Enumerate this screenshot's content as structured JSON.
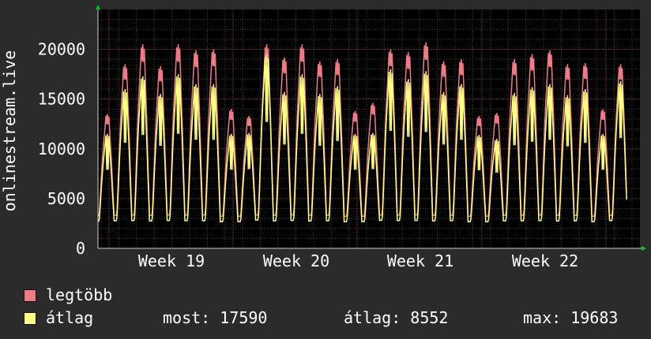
{
  "chart_data": {
    "type": "line",
    "ylabel": "onlinestream.live",
    "ylim": [
      0,
      24000
    ],
    "y_ticks": [
      0,
      5000,
      10000,
      15000,
      20000
    ],
    "y_tick_labels": [
      "0",
      "5000",
      "10000",
      "15000",
      "20000"
    ],
    "x_tick_labels": [
      "Week 19",
      "Week 20",
      "Week 21",
      "Week 22"
    ],
    "grid": true,
    "series": [
      {
        "name": "legtöbb",
        "color": "#f07a85",
        "daily_peaks": [
          13500,
          18500,
          20500,
          18300,
          20500,
          19900,
          20000,
          14000,
          13300,
          20500,
          19200,
          20500,
          18800,
          19000,
          13800,
          14600,
          20000,
          19700,
          20700,
          18800,
          19000,
          13300,
          13600,
          19000,
          19500,
          19900,
          18500,
          18600,
          14000,
          18500
        ]
      },
      {
        "name": "átlag",
        "color": "#ffff80",
        "daily_peaks": [
          11500,
          16000,
          17300,
          15500,
          17500,
          16500,
          16500,
          11500,
          11600,
          19500,
          15700,
          17500,
          15500,
          16300,
          11500,
          11600,
          18000,
          17000,
          17800,
          15700,
          16500,
          11400,
          11000,
          15600,
          16200,
          16500,
          15400,
          16000,
          11500,
          16800
        ]
      }
    ]
  },
  "legend": {
    "max_label": "legtöbb",
    "avg_label": "átlag"
  },
  "stats": {
    "now": "most: 17590",
    "avg": "átlag: 8552",
    "max": "max: 19683"
  },
  "colors": {
    "background": "#2b2b2b",
    "plot_background": "#000000",
    "grid_major": "#7a3a3a",
    "grid_minor": "#444444",
    "axis": "#cccccc",
    "arrow": "#00cc00"
  }
}
